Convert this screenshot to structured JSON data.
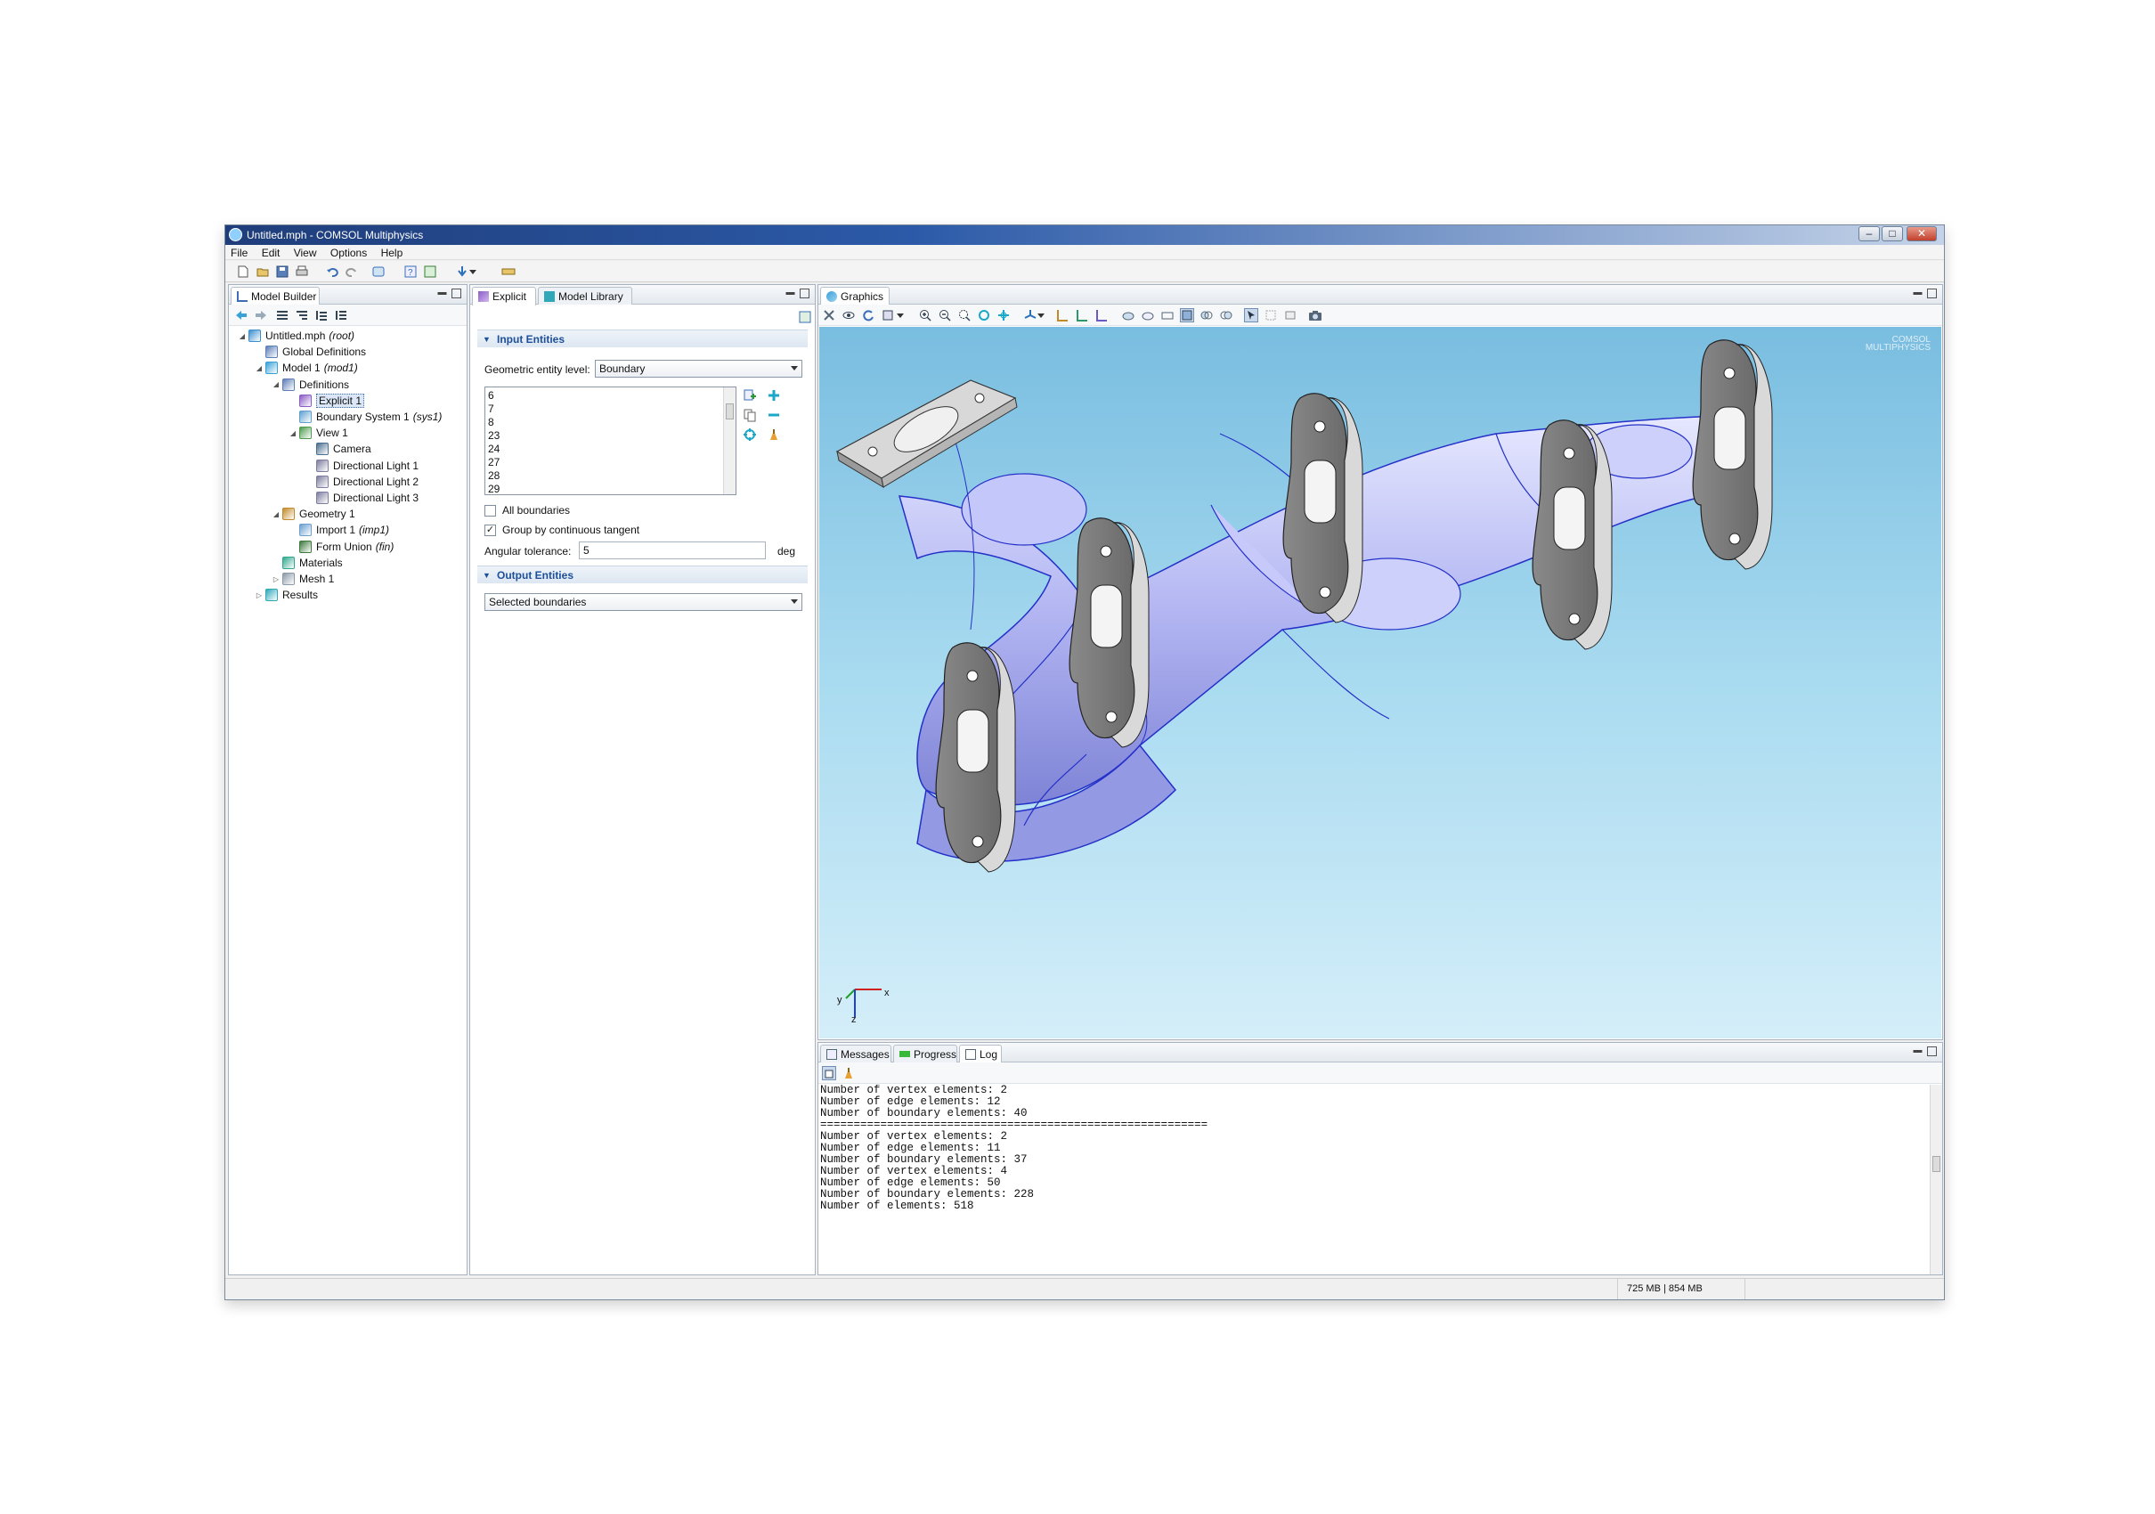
{
  "window": {
    "title": "Untitled.mph - COMSOL Multiphysics",
    "controls": {
      "minimize": "–",
      "maximize": "□",
      "close": "✕"
    }
  },
  "menu": [
    "File",
    "Edit",
    "View",
    "Options",
    "Help"
  ],
  "model_builder": {
    "tab_label": "Model Builder",
    "tree": [
      {
        "label": "Untitled.mph",
        "tag": "(root)",
        "level": 0,
        "expanded": true,
        "icon": "mph-file-icon",
        "color": "#3a8fd0"
      },
      {
        "label": "Global Definitions",
        "tag": "",
        "level": 1,
        "icon": "global-definitions-icon",
        "color": "#5d7fb8"
      },
      {
        "label": "Model 1",
        "tag": "(mod1)",
        "level": 1,
        "expanded": true,
        "icon": "model-icon",
        "color": "#3aa0d8"
      },
      {
        "label": "Definitions",
        "tag": "",
        "level": 2,
        "expanded": true,
        "icon": "definitions-icon",
        "color": "#5d7fb8"
      },
      {
        "label": "Explicit 1",
        "tag": "",
        "level": 3,
        "selected": true,
        "icon": "explicit-selection-icon",
        "color": "#8a5cc4"
      },
      {
        "label": "Boundary System 1",
        "tag": "(sys1)",
        "level": 3,
        "icon": "coordinate-system-icon",
        "color": "#5fa0d0"
      },
      {
        "label": "View 1",
        "tag": "",
        "level": 3,
        "expanded": true,
        "icon": "view-icon",
        "color": "#4e9a4e"
      },
      {
        "label": "Camera",
        "tag": "",
        "level": 4,
        "icon": "camera-icon",
        "color": "#4a6f8f"
      },
      {
        "label": "Directional Light 1",
        "tag": "",
        "level": 4,
        "icon": "light-icon",
        "color": "#7d7d9f"
      },
      {
        "label": "Directional Light 2",
        "tag": "",
        "level": 4,
        "icon": "light-icon",
        "color": "#7d7d9f"
      },
      {
        "label": "Directional Light 3",
        "tag": "",
        "level": 4,
        "icon": "light-icon",
        "color": "#7d7d9f"
      },
      {
        "label": "Geometry 1",
        "tag": "",
        "level": 2,
        "expanded": true,
        "icon": "geometry-icon",
        "color": "#c38a2a"
      },
      {
        "label": "Import 1",
        "tag": "(imp1)",
        "level": 3,
        "icon": "import-icon",
        "color": "#6a9fd0"
      },
      {
        "label": "Form Union",
        "tag": "(fin)",
        "level": 3,
        "icon": "form-union-icon",
        "color": "#3d7a3d"
      },
      {
        "label": "Materials",
        "tag": "",
        "level": 2,
        "icon": "materials-icon",
        "color": "#2fa890"
      },
      {
        "label": "Mesh 1",
        "tag": "",
        "level": 2,
        "collapsed": true,
        "icon": "mesh-icon",
        "color": "#8a9aa8"
      },
      {
        "label": "Results",
        "tag": "",
        "level": 1,
        "collapsed": true,
        "icon": "results-icon",
        "color": "#2fa8b8"
      }
    ]
  },
  "settings": {
    "tab_explicit": "Explicit",
    "tab_library": "Model Library",
    "input_section": "Input Entities",
    "entity_level_label": "Geometric entity level:",
    "entity_level_value": "Boundary",
    "selection_list": [
      "6",
      "7",
      "8",
      "23",
      "24",
      "27",
      "28",
      "29"
    ],
    "all_boundaries_label": "All boundaries",
    "all_boundaries_checked": false,
    "group_tangent_label": "Group by continuous tangent",
    "group_tangent_checked": true,
    "group_tangent_mark": "✓",
    "angular_tolerance_label": "Angular tolerance:",
    "angular_tolerance_value": "5",
    "angular_tolerance_unit": "deg",
    "output_section": "Output Entities",
    "output_value": "Selected boundaries"
  },
  "graphics": {
    "tab_label": "Graphics",
    "watermark_line1": "COMSOL",
    "watermark_line2": "MULTIPHYSICS",
    "axis_x": "x",
    "axis_y": "y",
    "axis_z": "z",
    "surface_color": "#aeb2f2",
    "edge_color": "#2430c8"
  },
  "log_panel": {
    "tab_messages": "Messages",
    "tab_progress": "Progress",
    "tab_log": "Log",
    "lines": [
      "Number of vertex elements: 2",
      "Number of edge elements: 12",
      "Number of boundary elements: 40",
      "==========================================================",
      "Number of vertex elements: 2",
      "Number of edge elements: 11",
      "Number of boundary elements: 37",
      "Number of vertex elements: 4",
      "Number of edge elements: 50",
      "Number of boundary elements: 228",
      "Number of elements: 518"
    ]
  },
  "status": {
    "memory": "725 MB | 854 MB"
  }
}
